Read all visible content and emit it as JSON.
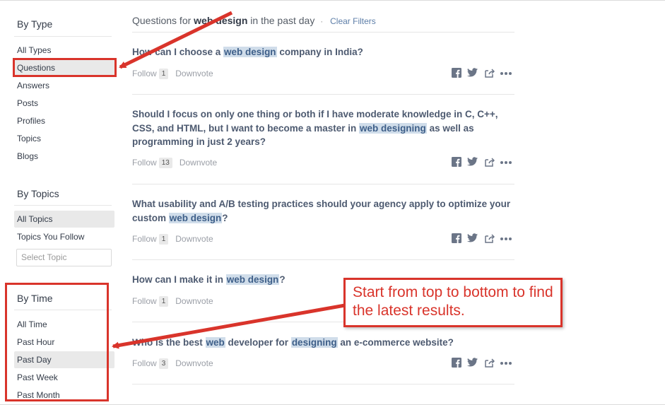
{
  "sidebar": {
    "by_type": {
      "title": "By Type",
      "items": [
        "All Types",
        "Questions",
        "Answers",
        "Posts",
        "Profiles",
        "Topics",
        "Blogs"
      ]
    },
    "by_topics": {
      "title": "By Topics",
      "items": [
        "All Topics",
        "Topics You Follow"
      ],
      "select_placeholder": "Select Topic"
    },
    "by_time": {
      "title": "By Time",
      "items": [
        "All Time",
        "Past Hour",
        "Past Day",
        "Past Week",
        "Past Month"
      ]
    }
  },
  "header": {
    "prefix": "Questions for",
    "query": "web design",
    "suffix": "in the past day",
    "separator": "·",
    "clear_filters": "Clear Filters"
  },
  "questions": [
    {
      "title_parts": [
        {
          "t": "How can I choose a "
        },
        {
          "t": "web design",
          "hl": true
        },
        {
          "t": " company in India?"
        }
      ],
      "follow": "Follow",
      "count": "1",
      "downvote": "Downvote"
    },
    {
      "title_parts": [
        {
          "t": "Should I focus on only one thing or both if I have moderate knowledge in C, C++, CSS, and HTML, but I want to become a master in "
        },
        {
          "t": "web designing",
          "hl": true
        },
        {
          "t": " as well as programming in just 2 years?"
        }
      ],
      "follow": "Follow",
      "count": "13",
      "downvote": "Downvote"
    },
    {
      "title_parts": [
        {
          "t": "What usability and A/B testing practices should your agency apply to optimize your custom "
        },
        {
          "t": "web design",
          "hl": true
        },
        {
          "t": "?"
        }
      ],
      "follow": "Follow",
      "count": "1",
      "downvote": "Downvote"
    },
    {
      "title_parts": [
        {
          "t": "How can I make it in "
        },
        {
          "t": "web design",
          "hl": true
        },
        {
          "t": "?"
        }
      ],
      "follow": "Follow",
      "count": "1",
      "downvote": "Downvote"
    },
    {
      "title_parts": [
        {
          "t": "Who is the best "
        },
        {
          "t": "web",
          "hl": true
        },
        {
          "t": " developer for "
        },
        {
          "t": "designing",
          "hl": true
        },
        {
          "t": " an e-commerce website?"
        }
      ],
      "follow": "Follow",
      "count": "3",
      "downvote": "Downvote"
    }
  ],
  "share_icons": [
    "facebook-icon",
    "twitter-icon",
    "share-icon",
    "more-icon"
  ],
  "annotation": {
    "callout_text": "Start from top to bottom to find the latest results."
  },
  "colors": {
    "annotation_red": "#d9342b",
    "highlight": "#d0ddea",
    "link_blue": "#5d7ea8",
    "title_text": "#4d5a70"
  }
}
